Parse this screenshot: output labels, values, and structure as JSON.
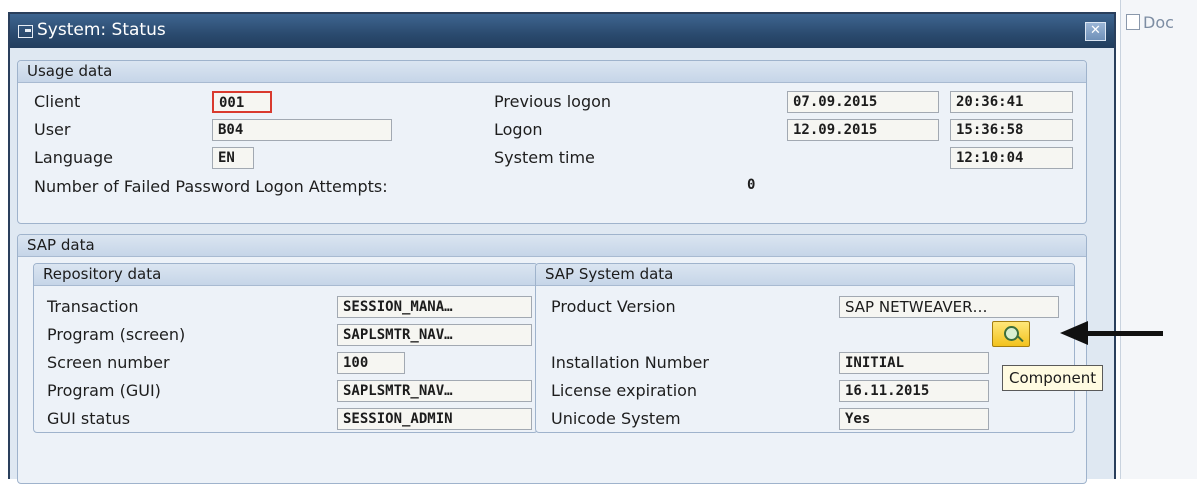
{
  "background": {
    "doc_text": "Doc"
  },
  "dialog": {
    "title": "System: Status",
    "close_glyph": "✕"
  },
  "usage": {
    "title": "Usage data",
    "client_label": "Client",
    "client_value": "001",
    "user_label": "User",
    "user_value": "B04",
    "language_label": "Language",
    "language_value": "EN",
    "prev_logon_label": "Previous logon",
    "prev_logon_date": "07.09.2015",
    "prev_logon_time": "20:36:41",
    "logon_label": "Logon",
    "logon_date": "12.09.2015",
    "logon_time": "15:36:58",
    "system_time_label": "System time",
    "system_time_value": "12:10:04",
    "failed_label": "Number of Failed Password Logon Attempts:",
    "failed_value": "0"
  },
  "sap": {
    "title": "SAP data",
    "repo": {
      "title": "Repository data",
      "transaction_label": "Transaction",
      "transaction_value": "SESSION_MANA…",
      "program_screen_label": "Program (screen)",
      "program_screen_value": "SAPLSMTR_NAV…",
      "screen_number_label": "Screen number",
      "screen_number_value": "100",
      "program_gui_label": "Program (GUI)",
      "program_gui_value": "SAPLSMTR_NAV…",
      "gui_status_label": "GUI status",
      "gui_status_value": "SESSION_ADMIN"
    },
    "system": {
      "title": "SAP System data",
      "product_version_label": "Product Version",
      "product_version_value": "SAP NETWEAVER…",
      "installation_label": "Installation Number",
      "installation_value": "INITIAL",
      "license_label": "License expiration",
      "license_value": "16.11.2015",
      "unicode_label": "Unicode System",
      "unicode_value": "Yes"
    }
  },
  "component": {
    "icon": "magnifier-icon",
    "tooltip": "Component"
  },
  "colors": {
    "titlebar": "#2a4a6e",
    "dialog_bg": "#dfe8f2",
    "focus": "#d93a2e",
    "button": "#f2c21d"
  }
}
